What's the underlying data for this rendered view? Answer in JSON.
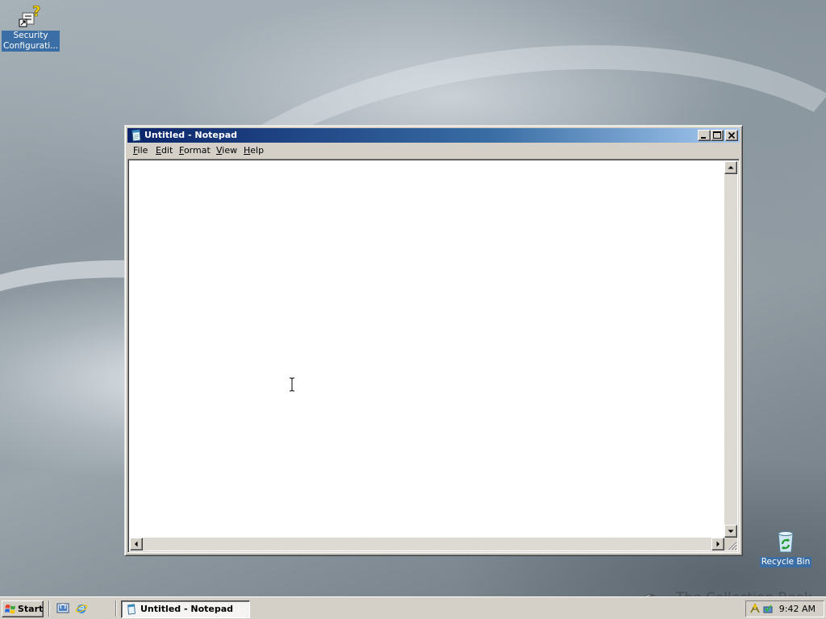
{
  "desktop": {
    "icons": [
      {
        "label": "Security Configurati...",
        "icon": "security-configuration-icon"
      },
      {
        "label": "Recycle Bin",
        "icon": "recycle-bin-icon"
      }
    ]
  },
  "window": {
    "title": "Untitled - Notepad",
    "icon": "notepad-icon",
    "controls": {
      "minimize": "minimize-icon",
      "maximize": "maximize-icon",
      "close": "close-icon"
    },
    "menu": [
      {
        "label": "File",
        "accel": "F",
        "rest": "ile"
      },
      {
        "label": "Edit",
        "accel": "E",
        "rest": "dit"
      },
      {
        "label": "Format",
        "accel": "F",
        "rest": "ormat"
      },
      {
        "label": "View",
        "accel": "V",
        "rest": "iew"
      },
      {
        "label": "Help",
        "accel": "H",
        "rest": "elp"
      }
    ],
    "content": ""
  },
  "taskbar": {
    "start_label": "Start",
    "quick_launch": [
      "show-desktop-icon",
      "internet-explorer-icon"
    ],
    "tasks": [
      {
        "label": "Untitled - Notepad",
        "icon": "notepad-icon",
        "active": true
      }
    ],
    "tray_icons": [
      "network-icon",
      "security-icon"
    ],
    "clock": "9:42 AM"
  },
  "watermark": {
    "text": "The Collection Book",
    "icon": "book-icon"
  },
  "colors": {
    "title_active_start": "#0a246a",
    "title_active_end": "#a6caf0",
    "face": "#d4d0c8",
    "desktop_label_bg": "#3b6ea5"
  }
}
